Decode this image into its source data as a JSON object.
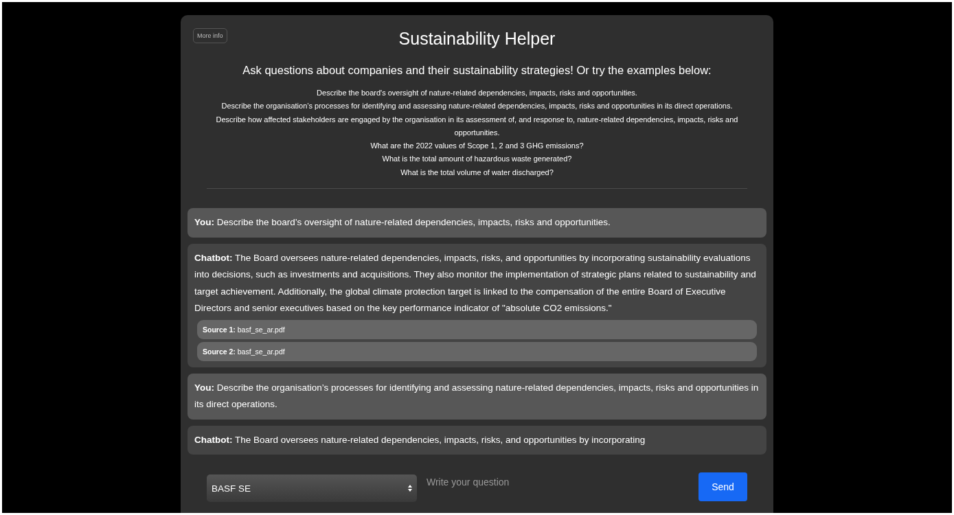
{
  "header": {
    "more_info_button": "More info",
    "title": "Sustainability Helper",
    "subtitle": "Ask questions about companies and their sustainability strategies! Or try the examples below:"
  },
  "examples": [
    "Describe the board's oversight of nature-related dependencies, impacts, risks and opportunities.",
    "Describe the organisation’s processes for identifying and assessing nature-related dependencies, impacts, risks and opportunities in its direct operations.",
    "Describe how affected stakeholders are engaged by the organisation in its assessment of, and response to, nature-related dependencies, impacts, risks and opportunities.",
    "What are the 2022 values of Scope 1, 2 and 3 GHG emissions?",
    "What is the total amount of hazardous waste generated?",
    "What is the total volume of water discharged?"
  ],
  "messages": [
    {
      "kind": "user",
      "text": "**You:** Describe the board’s oversight of nature-related dependencies, impacts, risks and opportunities."
    },
    {
      "kind": "bot",
      "text": "**Chatbot:** The Board oversees nature-related dependencies, impacts, risks, and opportunities by incorporating sustainability evaluations into decisions, such as investments and acquisitions. They also monitor the implementation of strategic plans related to sustainability and target achievement. Additionally, the global climate protection target is linked to the compensation of the entire Board of Executive Directors and senior executives based on the key performance indicator of \"absolute CO2 emissions.\"",
      "sources": [
        "**Source 1:** basf_se_ar.pdf",
        "**Source 2:** basf_se_ar.pdf"
      ]
    },
    {
      "kind": "user",
      "text": "**You:** Describe the organisation’s processes for identifying and assessing nature-related dependencies, impacts, risks and opportunities in its direct operations."
    },
    {
      "kind": "bot",
      "text": "**Chatbot:** The Board oversees nature-related dependencies, impacts, risks, and opportunities by incorporating"
    }
  ],
  "input_bar": {
    "company_select": "BASF SE",
    "question_field": {
      "placeholder": "Write your question"
    },
    "send_button": "Send"
  }
}
